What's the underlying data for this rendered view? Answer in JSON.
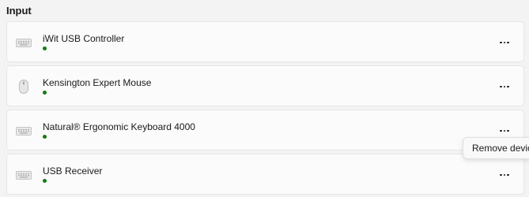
{
  "section": {
    "title": "Input"
  },
  "devices": [
    {
      "name": "iWit USB Controller",
      "icon": "keyboard-icon",
      "status_color": "#107c10"
    },
    {
      "name": "Kensington Expert Mouse",
      "icon": "mouse-icon",
      "status_color": "#107c10"
    },
    {
      "name": "Natural® Ergonomic Keyboard 4000",
      "icon": "keyboard-icon",
      "status_color": "#107c10"
    },
    {
      "name": "USB Receiver",
      "icon": "keyboard-icon",
      "status_color": "#107c10"
    }
  ],
  "context_menu": {
    "items": [
      {
        "label": "Remove device"
      }
    ]
  }
}
